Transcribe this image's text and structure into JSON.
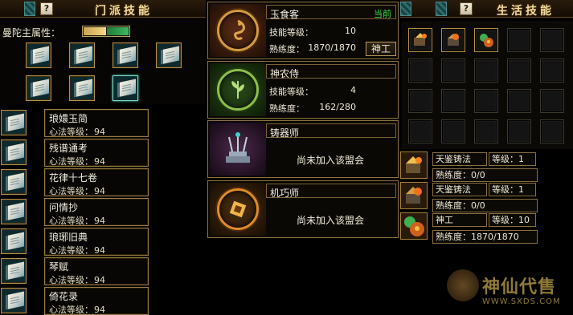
{
  "sect_panel": {
    "title": "门派技能",
    "help_label": "?",
    "attribute_label": "曼陀主属性：",
    "skills": [
      {
        "name": "琅嬛玉简",
        "level_label": "心法等级：",
        "level": "94"
      },
      {
        "name": "残谱通考",
        "level_label": "心法等级：",
        "level": "94"
      },
      {
        "name": "花律十七卷",
        "level_label": "心法等级：",
        "level": "94"
      },
      {
        "name": "问情抄",
        "level_label": "心法等级：",
        "level": "94"
      },
      {
        "name": "琅琊旧典",
        "level_label": "心法等级：",
        "level": "94"
      },
      {
        "name": "琴赋",
        "level_label": "心法等级：",
        "level": "94"
      },
      {
        "name": "倚花录",
        "level_label": "心法等级：",
        "level": "94"
      }
    ]
  },
  "leagues": [
    {
      "name": "玉食客",
      "status": "当前",
      "skill_label": "技能等级：",
      "skill_level": "10",
      "prof_label": "熟练度：",
      "proficiency": "1870/1870",
      "action": "神工",
      "emblem_icon": "dragon-emblem-icon",
      "color": "#4a2412"
    },
    {
      "name": "神农侍",
      "skill_label": "技能等级：",
      "skill_level": "4",
      "prof_label": "熟练度：",
      "proficiency": "162/280",
      "emblem_icon": "herb-emblem-icon",
      "color": "#1f3a16"
    },
    {
      "name": "铸器师",
      "message": "尚未加入该盟会",
      "emblem_icon": "forge-emblem-icon",
      "color": "#3a1f3a"
    },
    {
      "name": "机巧师",
      "message": "尚未加入该盟会",
      "emblem_icon": "gear-emblem-icon",
      "color": "#3a2510"
    }
  ],
  "life_panel": {
    "title": "生活技能",
    "help_label": "?",
    "entries": [
      {
        "name": "天鉴铸法",
        "level_label": "等级：",
        "level": "1",
        "prof_label": "熟练度：",
        "proficiency": "0/0"
      },
      {
        "name": "天鉴铸法",
        "level_label": "等级：",
        "level": "1",
        "prof_label": "熟练度：",
        "proficiency": "0/0"
      },
      {
        "name": "神工",
        "level_label": "等级：",
        "level": "10",
        "prof_label": "熟练度：",
        "proficiency": "1870/1870"
      }
    ]
  },
  "watermark": {
    "title": "神仙代售",
    "site": "WWW.SXDS.COM"
  },
  "colors": {
    "gold": "#d49a3e",
    "current_green": "#3be046",
    "panel_border": "#8e7440"
  }
}
